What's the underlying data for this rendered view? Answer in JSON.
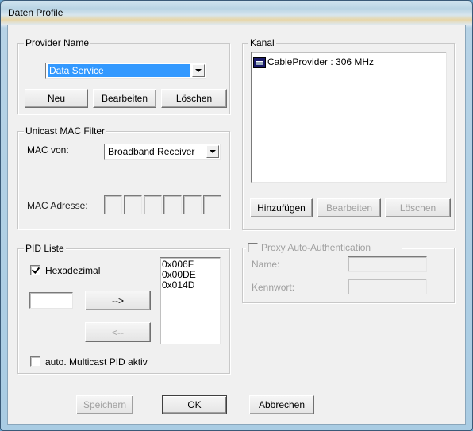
{
  "window": {
    "title": "Daten Profile"
  },
  "provider_name": {
    "group_label": "Provider Name",
    "selected": "Data Service",
    "buttons": {
      "new": "Neu",
      "edit": "Bearbeiten",
      "delete": "Löschen"
    }
  },
  "unicast_mac_filter": {
    "group_label": "Unicast MAC Filter",
    "mac_from_label": "MAC von:",
    "mac_from_value": "Broadband Receiver",
    "mac_address_label": "MAC Adresse:",
    "mac_octets": [
      "",
      "",
      "",
      "",
      "",
      ""
    ]
  },
  "pid_list": {
    "group_label": "PID Liste",
    "hex_label": "Hexadezimal",
    "hex_checked": true,
    "input_value": "",
    "add_button": "-->",
    "remove_button": "<--",
    "items": [
      "0x006F",
      "0x00DE",
      "0x014D"
    ],
    "auto_multicast_label": "auto. Multicast PID aktiv",
    "auto_multicast_checked": false
  },
  "kanal": {
    "group_label": "Kanal",
    "items": [
      {
        "icon": "channel-icon",
        "label": "CableProvider : 306 MHz"
      }
    ],
    "buttons": {
      "add": "Hinzufügen",
      "edit": "Bearbeiten",
      "delete": "Löschen"
    }
  },
  "proxy": {
    "group_label": "Proxy Auto-Authentication",
    "checked": false,
    "name_label": "Name:",
    "name_value": "",
    "password_label": "Kennwort:",
    "password_value": ""
  },
  "footer": {
    "save": "Speichern",
    "ok": "OK",
    "cancel": "Abbrechen"
  }
}
